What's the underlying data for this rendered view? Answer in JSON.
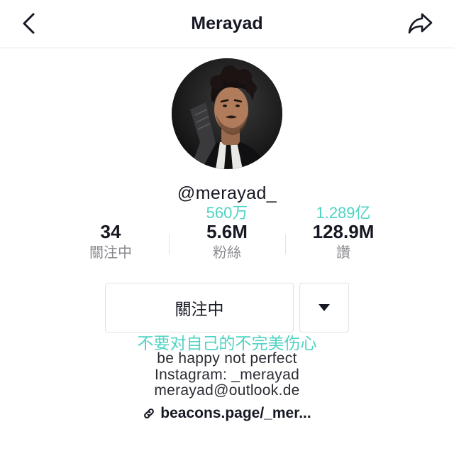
{
  "header": {
    "title": "Merayad",
    "back_icon": "chevron-left-icon",
    "share_icon": "share-arrow-icon"
  },
  "profile": {
    "username": "@merayad_"
  },
  "annotations": {
    "followers": "560万",
    "likes": "1.289亿",
    "bio": "不要对自己的不完美伤心"
  },
  "stats": [
    {
      "value": "34",
      "label": "關注中"
    },
    {
      "value": "5.6M",
      "label": "粉絲"
    },
    {
      "value": "128.9M",
      "label": "讚"
    }
  ],
  "actions": {
    "follow_label": "關注中",
    "dropdown_icon": "triangle-down-icon"
  },
  "bio": {
    "lines": [
      "be happy not perfect",
      "Instagram: _merayad",
      "merayad@outlook.de"
    ],
    "link": "beacons.page/_mer...",
    "link_icon": "link-icon"
  },
  "colors": {
    "text": "#161823",
    "secondary_text": "#8a8b91",
    "annotation": "#4fd3c4",
    "border": "#e1e1e3",
    "background": "#ffffff"
  }
}
